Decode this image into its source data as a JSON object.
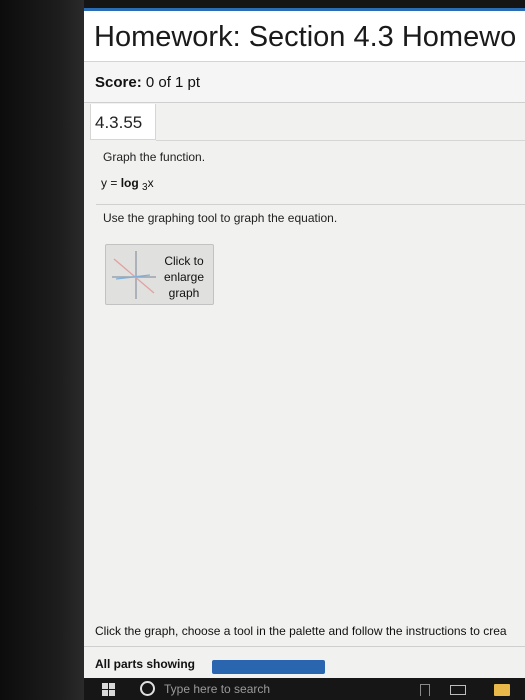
{
  "header": {
    "title": "Homework: Section 4.3 Homewo"
  },
  "score": {
    "label": "Score:",
    "value": "0 of 1 pt"
  },
  "question": {
    "number": "4.3.55",
    "instruction": "Graph the function.",
    "equation_prefix": "y = ",
    "equation_log": "log",
    "equation_base": "3",
    "equation_arg": "x",
    "tool_instruction": "Use the graphing tool to graph the equation.",
    "enlarge_button_label": "Click to\nenlarge\ngraph"
  },
  "footer": {
    "instruction": "Click the graph, choose a tool in the palette and follow the instructions to crea",
    "parts_label": "All parts showing",
    "progress_fraction": 1.0
  },
  "taskbar": {
    "search_placeholder": "Type here to search"
  },
  "icons": {
    "start": "windows-start-icon",
    "cortana": "cortana-circle-icon",
    "graph_thumbnail": "graph-axes-icon",
    "task_view": "task-view-icon",
    "window": "window-icon",
    "folder": "folder-icon"
  },
  "colors": {
    "accent": "#2a6db5",
    "progress": "#2a66b0"
  }
}
